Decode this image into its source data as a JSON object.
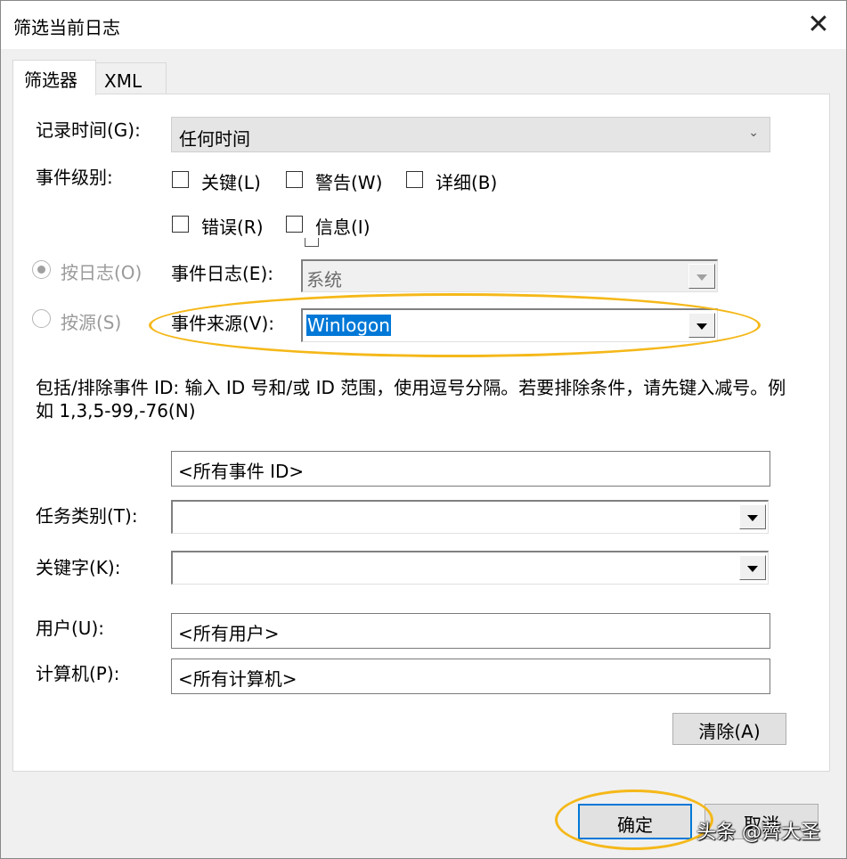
{
  "window": {
    "title": "筛选当前日志",
    "close_glyph": "✕"
  },
  "tabs": [
    {
      "label": "筛选器",
      "active": true
    },
    {
      "label": "XML",
      "active": false
    }
  ],
  "logged": {
    "label": "记录时间(G):",
    "value": "任何时间",
    "chevron": "⌄"
  },
  "level": {
    "label": "事件级别:",
    "checkboxes": [
      {
        "label": "关键(L)",
        "checked": false
      },
      {
        "label": "警告(W)",
        "checked": false
      },
      {
        "label": "详细(B)",
        "checked": false
      },
      {
        "label": "错误(R)",
        "checked": false
      },
      {
        "label": "信息(I)",
        "checked": false
      }
    ]
  },
  "by_log": {
    "radio_label": "按日志(O)",
    "selected": true,
    "field_label": "事件日志(E):",
    "value": "系统"
  },
  "by_source": {
    "radio_label": "按源(S)",
    "selected": false,
    "field_label": "事件来源(V):",
    "value": "Winlogon"
  },
  "event_ids": {
    "description": "包括/排除事件 ID: 输入 ID 号和/或 ID 范围，使用逗号分隔。若要排除条件，请先键入减号。例如 1,3,5-99,-76(N)",
    "value": "<所有事件 ID>"
  },
  "task_category": {
    "label": "任务类别(T):",
    "value": ""
  },
  "keywords": {
    "label": "关键字(K):",
    "value": ""
  },
  "user": {
    "label": "用户(U):",
    "value": "<所有用户>"
  },
  "computer": {
    "label": "计算机(P):",
    "value": "<所有计算机>"
  },
  "buttons": {
    "clear": "清除(A)",
    "ok": "确定",
    "cancel": "取消"
  },
  "watermark": "头条 @薺大圣",
  "colors": {
    "selection": "#0078d7",
    "highlight_ellipse": "#f5b819"
  }
}
